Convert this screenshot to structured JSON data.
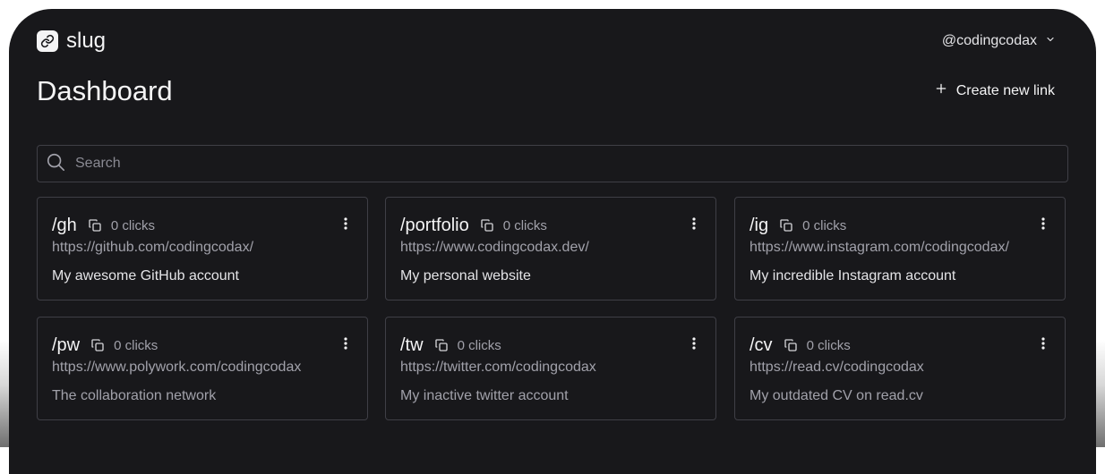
{
  "app": {
    "name": "slug"
  },
  "user": {
    "handle": "@codingcodax"
  },
  "page": {
    "title": "Dashboard",
    "create_label": "Create new link"
  },
  "search": {
    "placeholder": "Search"
  },
  "links": [
    {
      "slug": "/gh",
      "clicks": "0 clicks",
      "url": "https://github.com/codingcodax/",
      "description": "My awesome GitHub account"
    },
    {
      "slug": "/portfolio",
      "clicks": "0 clicks",
      "url": "https://www.codingcodax.dev/",
      "description": "My personal website"
    },
    {
      "slug": "/ig",
      "clicks": "0 clicks",
      "url": "https://www.instagram.com/codingcodax/",
      "description": "My incredible Instagram account"
    },
    {
      "slug": "/pw",
      "clicks": "0 clicks",
      "url": "https://www.polywork.com/codingcodax",
      "description": "The collaboration network"
    },
    {
      "slug": "/tw",
      "clicks": "0 clicks",
      "url": "https://twitter.com/codingcodax",
      "description": "My inactive twitter account"
    },
    {
      "slug": "/cv",
      "clicks": "0 clicks",
      "url": "https://read.cv/codingcodax",
      "description": "My outdated CV on read.cv"
    }
  ],
  "icons": {
    "brand": "link-icon",
    "user_menu": "chevron-down-icon",
    "create": "plus-icon",
    "search": "search-icon",
    "copy": "copy-icon",
    "menu": "more-vertical-icon"
  },
  "colors": {
    "background": "#18181b",
    "border": "#3f3f46",
    "text": "#f4f4f5",
    "muted": "#a1a1aa"
  }
}
